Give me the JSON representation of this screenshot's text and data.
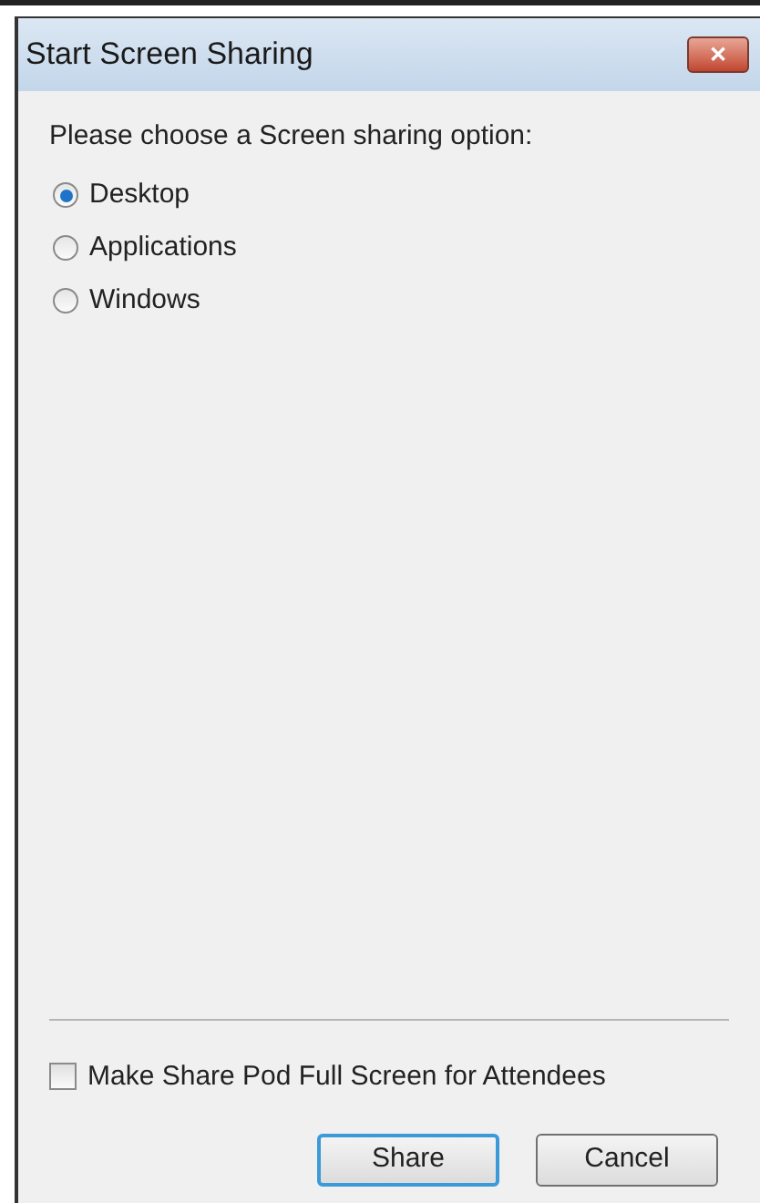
{
  "window": {
    "title": "Start Screen Sharing",
    "close_button": "✕"
  },
  "prompt": "Please choose a Screen sharing option:",
  "options": [
    {
      "label": "Desktop",
      "selected": true
    },
    {
      "label": "Applications",
      "selected": false
    },
    {
      "label": "Windows",
      "selected": false
    }
  ],
  "full_screen_option": {
    "label": "Make Share Pod Full Screen for Attendees",
    "checked": false
  },
  "buttons": [
    {
      "label": "Share",
      "kind": "default"
    },
    {
      "label": "Cancel",
      "kind": "normal"
    }
  ]
}
